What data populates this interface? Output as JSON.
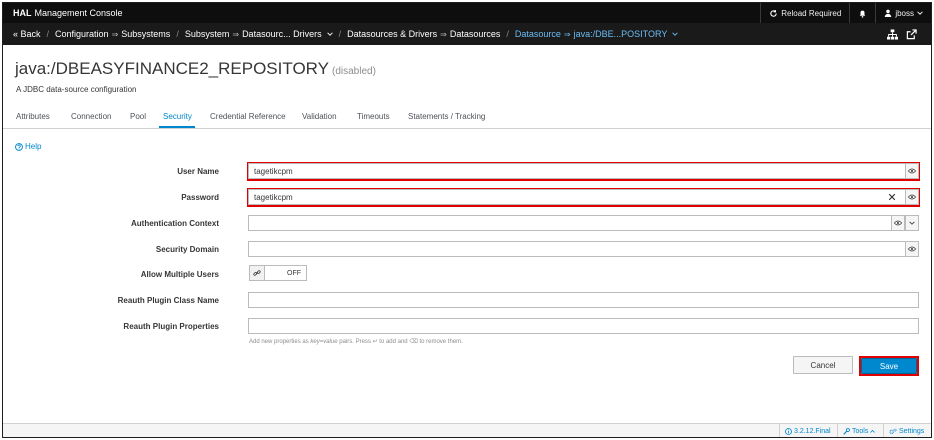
{
  "topbar": {
    "brand_strong": "HAL",
    "brand_rest": "Management Console",
    "reload_label": "Reload Required",
    "user": "jboss"
  },
  "nav": {
    "back": "« Back",
    "configuration": "Configuration",
    "subsystems": "Subsystems",
    "subsystem": "Subsystem",
    "datasourc_drivers": "Datasourc... Drivers",
    "datasources_drivers": "Datasources & Drivers",
    "datasources": "Datasources",
    "datasource": "Datasource",
    "current": "java:/DBE...POSITORY"
  },
  "header": {
    "title": "java:/DBEASYFINANCE2_REPOSITORY",
    "status": "(disabled)",
    "subtitle": "A JDBC data-source configuration"
  },
  "tabs": [
    {
      "label": "Attributes"
    },
    {
      "label": "Connection"
    },
    {
      "label": "Pool"
    },
    {
      "label": "Security"
    },
    {
      "label": "Credential Reference"
    },
    {
      "label": "Validation"
    },
    {
      "label": "Timeouts"
    },
    {
      "label": "Statements / Tracking"
    }
  ],
  "active_tab": "Security",
  "help_label": "Help",
  "form": {
    "user_name": {
      "label": "User Name",
      "value": "tagetikcpm"
    },
    "password": {
      "label": "Password",
      "value": "tagetikcpm"
    },
    "auth_context": {
      "label": "Authentication Context",
      "value": ""
    },
    "security_domain": {
      "label": "Security Domain",
      "value": ""
    },
    "allow_multiple_users": {
      "label": "Allow Multiple Users",
      "state": "OFF"
    },
    "reauth_class": {
      "label": "Reauth Plugin Class Name",
      "value": ""
    },
    "reauth_props": {
      "label": "Reauth Plugin Properties",
      "value": ""
    }
  },
  "hint": {
    "a": "Add new properties as ",
    "b": "key=value",
    "c": " pairs. Press ",
    "d": "↵",
    "e": " to add and ",
    "f": "⌫",
    "g": " to remove them."
  },
  "buttons": {
    "cancel": "Cancel",
    "save": "Save"
  },
  "footer": {
    "version": "3.2.12.Final",
    "tools": "Tools",
    "settings": "Settings"
  },
  "colors": {
    "accent": "#0088ce",
    "highlight": "#e00000",
    "topbar": "#0e0e0e"
  }
}
